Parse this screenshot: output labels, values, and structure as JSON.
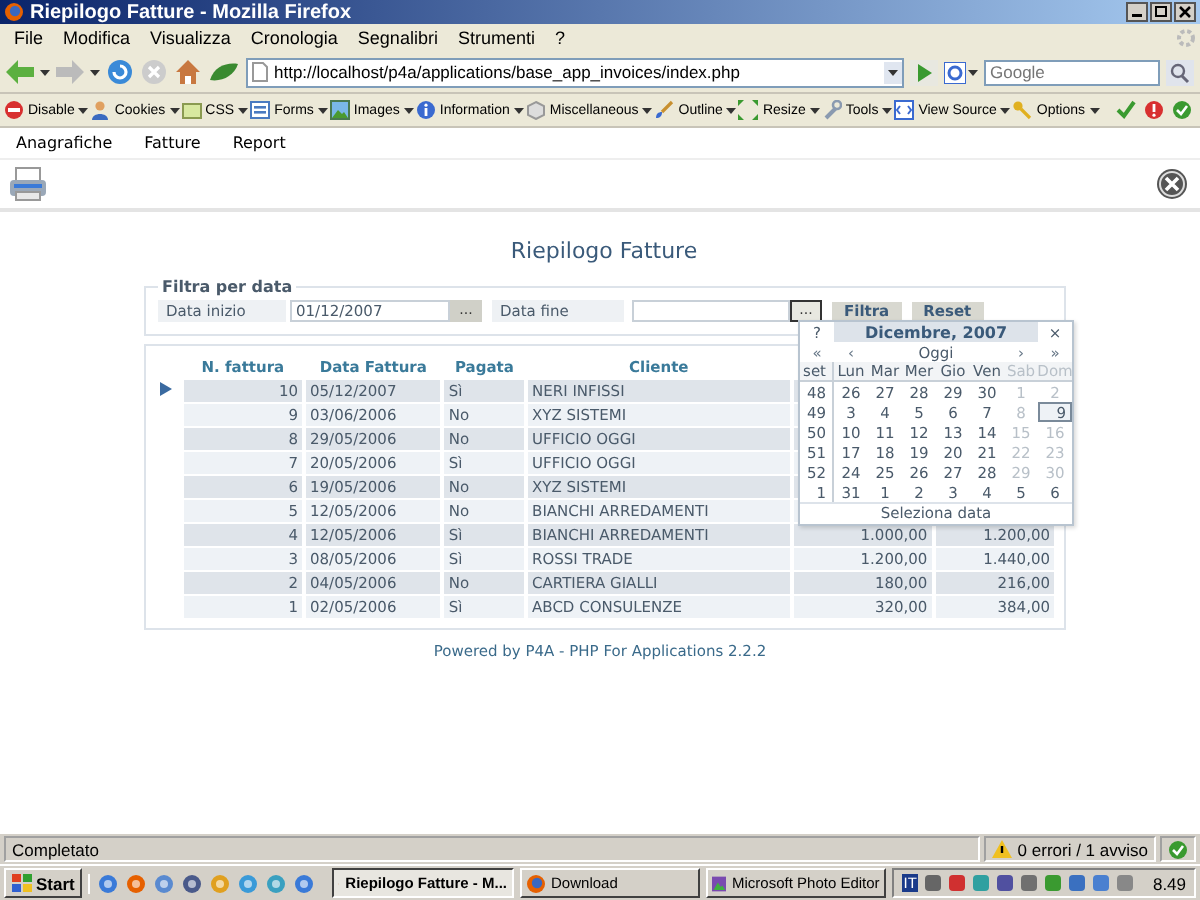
{
  "window": {
    "title": "Riepilogo Fatture - Mozilla Firefox"
  },
  "menu_bar": [
    "File",
    "Modifica",
    "Visualizza",
    "Cronologia",
    "Segnalibri",
    "Strumenti",
    "?"
  ],
  "nav_toolbar": {
    "url": "http://localhost/p4a/applications/base_app_invoices/index.php",
    "search": {
      "placeholder": "Google"
    }
  },
  "developer_toolbar": [
    {
      "label": "Disable",
      "kind": "stop"
    },
    {
      "label": "Cookies",
      "kind": "person"
    },
    {
      "label": "CSS",
      "kind": "page"
    },
    {
      "label": "Forms",
      "kind": "form"
    },
    {
      "label": "Images",
      "kind": "image"
    },
    {
      "label": "Information",
      "kind": "info"
    },
    {
      "label": "Miscellaneous",
      "kind": "box"
    },
    {
      "label": "Outline",
      "kind": "brush"
    },
    {
      "label": "Resize",
      "kind": "resize"
    },
    {
      "label": "Tools",
      "kind": "wrench"
    },
    {
      "label": "View Source",
      "kind": "source"
    },
    {
      "label": "Options",
      "kind": "key"
    }
  ],
  "app_menu": [
    "Anagrafiche",
    "Fatture",
    "Report"
  ],
  "page_title": "Riepilogo Fatture",
  "filter": {
    "legend": "Filtra per data",
    "start_label": "Data inizio",
    "start_value": "01/12/2007",
    "start_button": "...",
    "end_label": "Data fine",
    "end_button": "...",
    "buttons": [
      "Filtra",
      "Reset"
    ]
  },
  "table": {
    "columns": [
      "N. fattura",
      "Data Fattura",
      "Pagata",
      "Cliente"
    ],
    "rows": [
      {
        "number": "10",
        "date": "05/12/2007",
        "paid": "Sì",
        "client": "NERI INFISSI",
        "selected": true
      },
      {
        "number": "9",
        "date": "03/06/2006",
        "paid": "No",
        "client": "XYZ SISTEMI",
        "selected": false
      },
      {
        "number": "8",
        "date": "29/05/2006",
        "paid": "No",
        "client": "UFFICIO OGGI",
        "selected": false
      },
      {
        "number": "7",
        "date": "20/05/2006",
        "paid": "Sì",
        "client": "UFFICIO OGGI",
        "selected": false
      },
      {
        "number": "6",
        "date": "19/05/2006",
        "paid": "No",
        "client": "XYZ SISTEMI",
        "selected": false
      },
      {
        "number": "5",
        "date": "12/05/2006",
        "paid": "No",
        "client": "BIANCHI ARREDAMENTI",
        "selected": false
      },
      {
        "number": "4",
        "date": "12/05/2006",
        "paid": "Sì",
        "client": "BIANCHI ARREDAMENTI",
        "column_5": "1.000,00",
        "column_6": "1.200,00",
        "selected": false
      },
      {
        "number": "3",
        "date": "08/05/2006",
        "paid": "Sì",
        "client": "ROSSI TRADE",
        "column_5": "1.200,00",
        "column_6": "1.440,00",
        "selected": false
      },
      {
        "number": "2",
        "date": "04/05/2006",
        "paid": "No",
        "client": "CARTIERA GIALLI",
        "column_5": "180,00",
        "column_6": "216,00",
        "selected": false
      },
      {
        "number": "1",
        "date": "02/05/2006",
        "paid": "Sì",
        "client": "ABCD CONSULENZE",
        "column_5": "320,00",
        "column_6": "384,00",
        "selected": false
      }
    ]
  },
  "calendar": {
    "help": "?",
    "title": "Dicembre, 2007",
    "close": "×",
    "nav": [
      "«",
      "‹",
      "Oggi",
      "›",
      "»"
    ],
    "week_label": "set",
    "day_names": [
      {
        "label": "Lun",
        "weekend": false
      },
      {
        "label": "Mar",
        "weekend": false
      },
      {
        "label": "Mer",
        "weekend": false
      },
      {
        "label": "Gio",
        "weekend": false
      },
      {
        "label": "Ven",
        "weekend": false
      },
      {
        "label": "Sab",
        "weekend": true
      },
      {
        "label": "Dom",
        "weekend": true
      }
    ],
    "weeks": [
      {
        "week": "48",
        "days": [
          {
            "d": "26",
            "muted": false,
            "selected": false
          },
          {
            "d": "27",
            "muted": false,
            "selected": false
          },
          {
            "d": "28",
            "muted": false,
            "selected": false
          },
          {
            "d": "29",
            "muted": false,
            "selected": false
          },
          {
            "d": "30",
            "muted": false,
            "selected": false
          },
          {
            "d": "1",
            "muted": true,
            "selected": false
          },
          {
            "d": "2",
            "muted": true,
            "selected": false
          }
        ]
      },
      {
        "week": "49",
        "days": [
          {
            "d": "3",
            "muted": false,
            "selected": false
          },
          {
            "d": "4",
            "muted": false,
            "selected": false
          },
          {
            "d": "5",
            "muted": false,
            "selected": false
          },
          {
            "d": "6",
            "muted": false,
            "selected": false
          },
          {
            "d": "7",
            "muted": false,
            "selected": false
          },
          {
            "d": "8",
            "muted": true,
            "selected": false
          },
          {
            "d": "9",
            "muted": false,
            "selected": true
          }
        ]
      },
      {
        "week": "50",
        "days": [
          {
            "d": "10",
            "muted": false,
            "selected": false
          },
          {
            "d": "11",
            "muted": false,
            "selected": false
          },
          {
            "d": "12",
            "muted": false,
            "selected": false
          },
          {
            "d": "13",
            "muted": false,
            "selected": false
          },
          {
            "d": "14",
            "muted": false,
            "selected": false
          },
          {
            "d": "15",
            "muted": true,
            "selected": false
          },
          {
            "d": "16",
            "muted": true,
            "selected": false
          }
        ]
      },
      {
        "week": "51",
        "days": [
          {
            "d": "17",
            "muted": false,
            "selected": false
          },
          {
            "d": "18",
            "muted": false,
            "selected": false
          },
          {
            "d": "19",
            "muted": false,
            "selected": false
          },
          {
            "d": "20",
            "muted": false,
            "selected": false
          },
          {
            "d": "21",
            "muted": false,
            "selected": false
          },
          {
            "d": "22",
            "muted": true,
            "selected": false
          },
          {
            "d": "23",
            "muted": true,
            "selected": false
          }
        ]
      },
      {
        "week": "52",
        "days": [
          {
            "d": "24",
            "muted": false,
            "selected": false
          },
          {
            "d": "25",
            "muted": false,
            "selected": false
          },
          {
            "d": "26",
            "muted": false,
            "selected": false
          },
          {
            "d": "27",
            "muted": false,
            "selected": false
          },
          {
            "d": "28",
            "muted": false,
            "selected": false
          },
          {
            "d": "29",
            "muted": true,
            "selected": false
          },
          {
            "d": "30",
            "muted": true,
            "selected": false
          }
        ]
      },
      {
        "week": "1",
        "days": [
          {
            "d": "31",
            "muted": false,
            "selected": false
          },
          {
            "d": "1",
            "muted": false,
            "selected": false
          },
          {
            "d": "2",
            "muted": false,
            "selected": false
          },
          {
            "d": "3",
            "muted": false,
            "selected": false
          },
          {
            "d": "4",
            "muted": false,
            "selected": false
          },
          {
            "d": "5",
            "muted": false,
            "selected": false
          },
          {
            "d": "6",
            "muted": false,
            "selected": false
          }
        ]
      }
    ],
    "footer": "Seleziona data"
  },
  "footer": {
    "prefix": "Powered by",
    "link": "P4A - PHP For Applications",
    "version": "2.2.2"
  },
  "status_bar": {
    "text": "Completato",
    "messages": "0 errori / 1 avviso"
  },
  "taskbar": {
    "start": "Start",
    "tasks": [
      {
        "label": "Riepilogo Fatture - M...",
        "selected": true
      },
      {
        "label": "Download",
        "selected": false
      },
      {
        "label": "Microsoft Photo Editor",
        "selected": false
      }
    ],
    "language": "IT",
    "clock": "8.49"
  }
}
